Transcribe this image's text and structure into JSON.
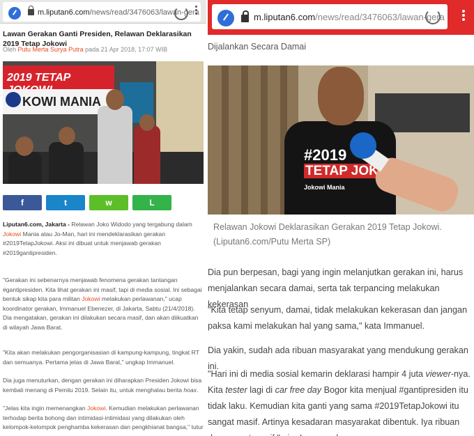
{
  "left": {
    "browser": {
      "url_domain": "m.liputan6.com",
      "url_path": "/news/read/3476063/lawan-gera"
    },
    "headline": "Lawan Gerakan Ganti Presiden, Relawan Deklarasikan 2019 Tetap Jokowi",
    "byline": {
      "prefix": "Oleh",
      "author": "Putu Merta Surya Putra",
      "date": "pada 21 Apr 2018, 17:07 WIB"
    },
    "photo": {
      "banner_text": "2019 TETAP JOKOWI",
      "banner_text2": "KOWI MANIA",
      "shirt_text": "#2019"
    },
    "share_buttons": [
      {
        "name": "facebook",
        "icon": "f",
        "color": "#3b5998"
      },
      {
        "name": "twitter",
        "icon": "t",
        "color": "#1a85c8"
      },
      {
        "name": "whatsapp",
        "icon": "w",
        "color": "#5cbf2a"
      },
      {
        "name": "line",
        "icon": "L",
        "color": "#34b34a"
      }
    ],
    "paragraphs": {
      "p1": {
        "source": "Liputan6.com, Jakarta -",
        "t1": " Relawan Joko Widodo yang tergabung dalam ",
        "kw1": "Jokowi",
        "t2": " Mania atau Jo-Man, hari ini mendeklarasikan gerakan #2019TetapJokowi. Aksi ini dibuat untuk menjawab gerakan #2019gantipresiden."
      },
      "p2": {
        "t1": "\"Gerakan ini sebenarnya menjawab fenomena gerakan tantangan #gantipresiden. Kita lihat gerakan ini masif, tapi di media sosial. Ini sebagai bentuk sikap kita para militan ",
        "kw1": "Jokowi",
        "t2": " melakukan perlawanan,\" ucap koordinator gerakan, Immanuel Ebenezer, di Jakarta, Sabtu (21/4/2018). Dia mengatakan, gerakan ini dilakukan secara masif, dan akan diikuatkan di wilayah Jawa Barat."
      },
      "p3": "\"Kita akan melakukan pengorganisasian di kampung-kampung, tingkat RT dan semuanya. Pertama jelas di Jawa Barat,\" ungkap Immanuel.",
      "p4": {
        "t1": "Dia juga menuturkan, dengan gerakan ini diharapkan Presiden Jokowi bisa kembali menang di Pemilu 2019. Selain itu, untuk menghalau berita ",
        "it": "hoax",
        "t2": "."
      },
      "p5": {
        "t1": "\"Jelas kita ingin memenangkan ",
        "kw1": "Jokowi",
        "t2": ". Kemudian melakukan perlawanan terhodap berita bohong dan intimidasi-intimidasi yang dilakukan oleh kelompok-kelompok penghamba kekerasan dan pengkhianat bangsa,\" tutur"
      }
    }
  },
  "right": {
    "browser": {
      "url_domain": "m.liputan6.com",
      "url_path": "/news/read/3476063/lawan-gera"
    },
    "subhead": "Dijalankan Secara Damai",
    "photo": {
      "shirt_line1": "#2019",
      "shirt_line2": "TETAP JOKOWI",
      "shirt_line3": "Jokowi Mania"
    },
    "caption": "Relawan Jokowi Deklarasikan Gerakan 2019 Tetap Jokowi. (Liputan6.com/Putu Merta SP)",
    "paragraphs": {
      "p1": "Dia pun berpesan, bagi yang ingin melanjutkan gerakan ini, harus menjalankan secara damai, serta tak terpancing melakukan kekerasan",
      "p2": "\"Kita tetap senyum, damai, tidak melakukan kekerasan dan jangan paksa kami melakukan hal yang sama,\" kata Immanuel.",
      "p3": "Dia yakin, sudah ada ribuan masyarakat yang mendukung gerakan ini.",
      "p4": {
        "t1": "\"Hari ini di media sosial kemarin deklarasi hampir 4 juta ",
        "it1": "viewer",
        "t2": "-nya. Kita ",
        "it2": "tester",
        "t3": " lagi di ",
        "it3": "car free day",
        "t4": " Bogor kita menjual #gantipresiden itu tidak laku. Kemudian kita ganti yang sama #2019TetapJokowi itu sangat masif. Artinya kesadaran masyarakat dibentuk. Iya ribuan dan sangat masif,\" ujar Immanuel."
      }
    }
  }
}
